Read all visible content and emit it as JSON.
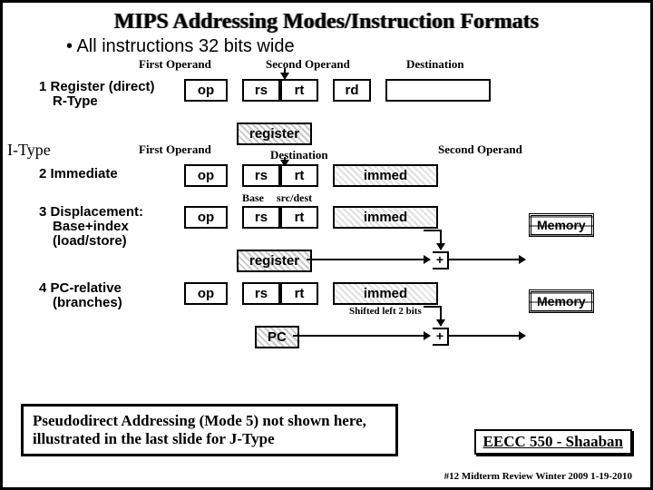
{
  "title": "MIPS Addressing Modes/Instruction Formats",
  "sub": "• All instructions 32 bits wide",
  "operands": {
    "first": "First Operand",
    "second": "Second Operand",
    "dest": "Destination"
  },
  "modes": {
    "m1a": "1 Register (direct)",
    "m1b": "R-Type",
    "itype": "I-Type",
    "m2": "2  Immediate",
    "m3a": "3 Displacement:",
    "m3b": "Base+index",
    "m3c": "(load/store)",
    "m4a": "4 PC-relative",
    "m4b": "(branches)"
  },
  "fields": {
    "op": "op",
    "rs": "rs",
    "rt": "rt",
    "rd": "rd",
    "immed": "immed",
    "register": "register",
    "pc": "PC",
    "base": "Base",
    "srcdest": "src/dest"
  },
  "other": {
    "memory": "Memory",
    "plus": "+",
    "shift": "Shifted left 2 bits"
  },
  "footer": {
    "note": "Pseudodirect Addressing (Mode 5) not shown here, illustrated in the last slide for J-Type",
    "course": "EECC 550 - Shaaban",
    "pg": "#12  Midterm Review  Winter 2009  1-19-2010"
  }
}
